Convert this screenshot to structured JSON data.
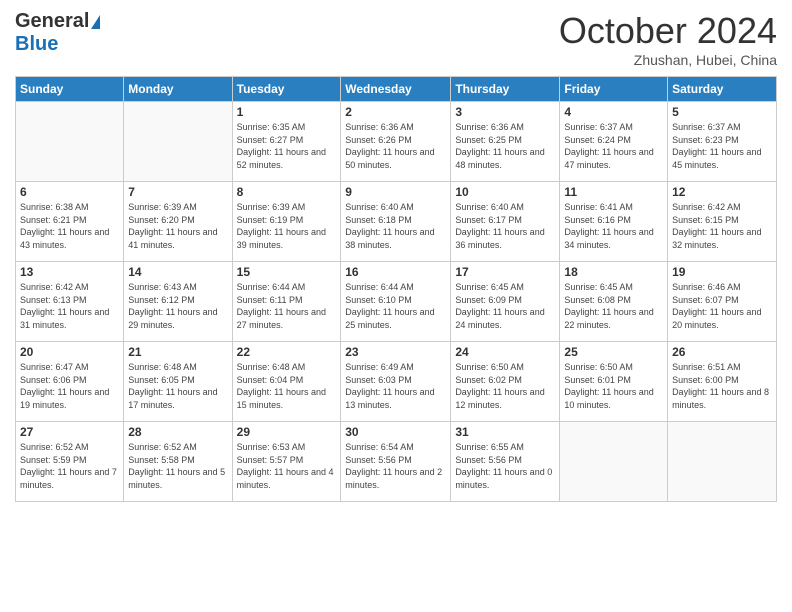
{
  "logo": {
    "general": "General",
    "blue": "Blue"
  },
  "header": {
    "month": "October 2024",
    "location": "Zhushan, Hubei, China"
  },
  "weekdays": [
    "Sunday",
    "Monday",
    "Tuesday",
    "Wednesday",
    "Thursday",
    "Friday",
    "Saturday"
  ],
  "weeks": [
    [
      {
        "day": "",
        "info": ""
      },
      {
        "day": "",
        "info": ""
      },
      {
        "day": "1",
        "info": "Sunrise: 6:35 AM\nSunset: 6:27 PM\nDaylight: 11 hours and 52 minutes."
      },
      {
        "day": "2",
        "info": "Sunrise: 6:36 AM\nSunset: 6:26 PM\nDaylight: 11 hours and 50 minutes."
      },
      {
        "day": "3",
        "info": "Sunrise: 6:36 AM\nSunset: 6:25 PM\nDaylight: 11 hours and 48 minutes."
      },
      {
        "day": "4",
        "info": "Sunrise: 6:37 AM\nSunset: 6:24 PM\nDaylight: 11 hours and 47 minutes."
      },
      {
        "day": "5",
        "info": "Sunrise: 6:37 AM\nSunset: 6:23 PM\nDaylight: 11 hours and 45 minutes."
      }
    ],
    [
      {
        "day": "6",
        "info": "Sunrise: 6:38 AM\nSunset: 6:21 PM\nDaylight: 11 hours and 43 minutes."
      },
      {
        "day": "7",
        "info": "Sunrise: 6:39 AM\nSunset: 6:20 PM\nDaylight: 11 hours and 41 minutes."
      },
      {
        "day": "8",
        "info": "Sunrise: 6:39 AM\nSunset: 6:19 PM\nDaylight: 11 hours and 39 minutes."
      },
      {
        "day": "9",
        "info": "Sunrise: 6:40 AM\nSunset: 6:18 PM\nDaylight: 11 hours and 38 minutes."
      },
      {
        "day": "10",
        "info": "Sunrise: 6:40 AM\nSunset: 6:17 PM\nDaylight: 11 hours and 36 minutes."
      },
      {
        "day": "11",
        "info": "Sunrise: 6:41 AM\nSunset: 6:16 PM\nDaylight: 11 hours and 34 minutes."
      },
      {
        "day": "12",
        "info": "Sunrise: 6:42 AM\nSunset: 6:15 PM\nDaylight: 11 hours and 32 minutes."
      }
    ],
    [
      {
        "day": "13",
        "info": "Sunrise: 6:42 AM\nSunset: 6:13 PM\nDaylight: 11 hours and 31 minutes."
      },
      {
        "day": "14",
        "info": "Sunrise: 6:43 AM\nSunset: 6:12 PM\nDaylight: 11 hours and 29 minutes."
      },
      {
        "day": "15",
        "info": "Sunrise: 6:44 AM\nSunset: 6:11 PM\nDaylight: 11 hours and 27 minutes."
      },
      {
        "day": "16",
        "info": "Sunrise: 6:44 AM\nSunset: 6:10 PM\nDaylight: 11 hours and 25 minutes."
      },
      {
        "day": "17",
        "info": "Sunrise: 6:45 AM\nSunset: 6:09 PM\nDaylight: 11 hours and 24 minutes."
      },
      {
        "day": "18",
        "info": "Sunrise: 6:45 AM\nSunset: 6:08 PM\nDaylight: 11 hours and 22 minutes."
      },
      {
        "day": "19",
        "info": "Sunrise: 6:46 AM\nSunset: 6:07 PM\nDaylight: 11 hours and 20 minutes."
      }
    ],
    [
      {
        "day": "20",
        "info": "Sunrise: 6:47 AM\nSunset: 6:06 PM\nDaylight: 11 hours and 19 minutes."
      },
      {
        "day": "21",
        "info": "Sunrise: 6:48 AM\nSunset: 6:05 PM\nDaylight: 11 hours and 17 minutes."
      },
      {
        "day": "22",
        "info": "Sunrise: 6:48 AM\nSunset: 6:04 PM\nDaylight: 11 hours and 15 minutes."
      },
      {
        "day": "23",
        "info": "Sunrise: 6:49 AM\nSunset: 6:03 PM\nDaylight: 11 hours and 13 minutes."
      },
      {
        "day": "24",
        "info": "Sunrise: 6:50 AM\nSunset: 6:02 PM\nDaylight: 11 hours and 12 minutes."
      },
      {
        "day": "25",
        "info": "Sunrise: 6:50 AM\nSunset: 6:01 PM\nDaylight: 11 hours and 10 minutes."
      },
      {
        "day": "26",
        "info": "Sunrise: 6:51 AM\nSunset: 6:00 PM\nDaylight: 11 hours and 8 minutes."
      }
    ],
    [
      {
        "day": "27",
        "info": "Sunrise: 6:52 AM\nSunset: 5:59 PM\nDaylight: 11 hours and 7 minutes."
      },
      {
        "day": "28",
        "info": "Sunrise: 6:52 AM\nSunset: 5:58 PM\nDaylight: 11 hours and 5 minutes."
      },
      {
        "day": "29",
        "info": "Sunrise: 6:53 AM\nSunset: 5:57 PM\nDaylight: 11 hours and 4 minutes."
      },
      {
        "day": "30",
        "info": "Sunrise: 6:54 AM\nSunset: 5:56 PM\nDaylight: 11 hours and 2 minutes."
      },
      {
        "day": "31",
        "info": "Sunrise: 6:55 AM\nSunset: 5:56 PM\nDaylight: 11 hours and 0 minutes."
      },
      {
        "day": "",
        "info": ""
      },
      {
        "day": "",
        "info": ""
      }
    ]
  ]
}
